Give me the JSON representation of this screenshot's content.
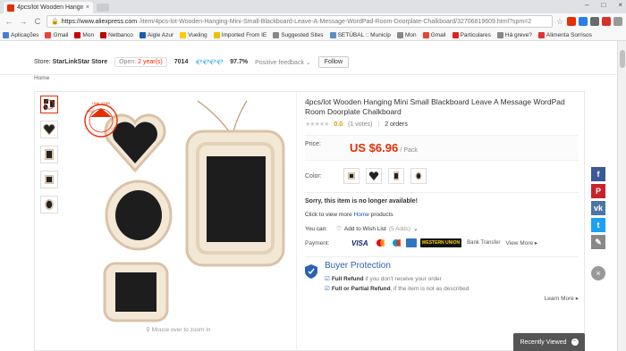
{
  "browser": {
    "tab_title": "4pcs/lot Wooden Hangin",
    "tab_close": "×",
    "window_buttons": [
      "–",
      "□",
      "×"
    ],
    "nav": {
      "back": "←",
      "forward": "→",
      "reload": "C"
    },
    "url_host": "https://www.aliexpress.com",
    "url_path": "/item/4pcs-lot-Wooden-Hanging-Mini-Small-Blackboard-Leave-A-Message-WordPad-Room-Doorplate-Chalkboard/32706819609.html?spm=2",
    "bookmarks": [
      "Aplicações",
      "Gmail",
      "Mon",
      "Netbanco",
      "Aigle Azur",
      "Vueling",
      "Imported From IE",
      "Suggested Sites",
      "SETÚBAL :: Municíp",
      "Mon",
      "Gmail",
      "Particulares",
      "Há greve?",
      "Alimenta Sorrisos"
    ]
  },
  "store": {
    "label": "Store:",
    "name": "StarLinkStar Store",
    "open_label": "Open:",
    "open_years": "2 year(s)",
    "score": "7014",
    "diamonds": "💎💎💎💎",
    "feedback_pct": "97.7%",
    "feedback_label": "Positive feedback",
    "follow": "Follow"
  },
  "breadcrumb": "Home",
  "gallery": {
    "zoom_hint": "Mouse over to zoom in"
  },
  "product": {
    "title": "4pcs/lot Wooden Hanging Mini Small Blackboard Leave A Message WordPad Room Doorplate Chalkboard",
    "stars": "★★★★★",
    "rating": "0.0",
    "votes": "(1 votes)",
    "orders": "2 orders",
    "price_label": "Price:",
    "price": "US $6.96",
    "per": "/ Pack",
    "color_label": "Color:",
    "unavailable": "Sorry, this item is no longer available!",
    "view_more_prefix": "Click to view more",
    "view_more_link": "Home",
    "view_more_suffix": "products",
    "you_can_label": "You can:",
    "wish_label": "Add to Wish List",
    "wish_count": "(5 Adds)",
    "payment_label": "Payment:",
    "payment_methods": [
      "VISA",
      "MC",
      "Maestro",
      "Amex",
      "WESTERN UNION",
      "Bank Transfer"
    ],
    "payment_viewmore": "View More ▸",
    "buyer_protection": "Buyer Protection",
    "bp1_bold": "Full Refund",
    "bp1_rest": "if you don't receive your order",
    "bp2_bold": "Full or Partial Refund",
    "bp2_rest": ", if the item is not as described",
    "learn_more": "Learn More ▸"
  },
  "recently_viewed": "Recently Viewed"
}
